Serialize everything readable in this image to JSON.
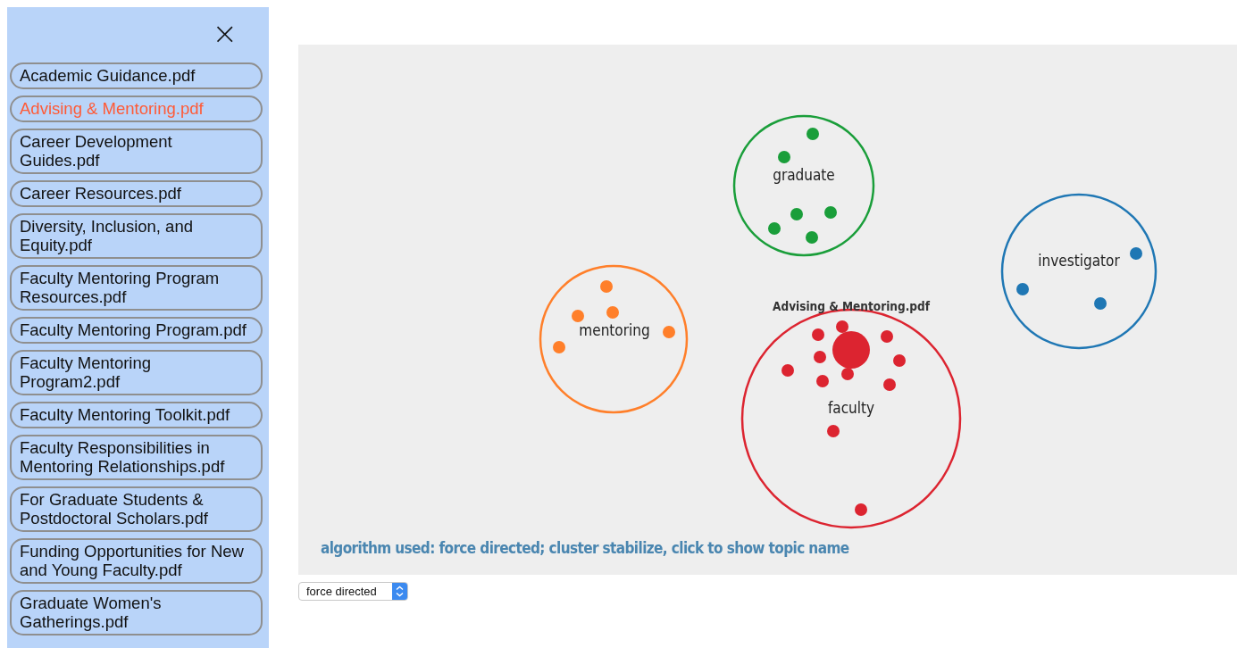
{
  "sidebar": {
    "close": "×",
    "files": [
      {
        "label": "Academic Guidance.pdf",
        "selected": false
      },
      {
        "label": "Advising & Mentoring.pdf",
        "selected": true
      },
      {
        "label": "Career Development Guides.pdf",
        "selected": false
      },
      {
        "label": "Career Resources.pdf",
        "selected": false
      },
      {
        "label": "Diversity, Inclusion, and Equity.pdf",
        "selected": false
      },
      {
        "label": "Faculty Mentoring Program Resources.pdf",
        "selected": false
      },
      {
        "label": "Faculty Mentoring Program.pdf",
        "selected": false
      },
      {
        "label": "Faculty Mentoring Program2.pdf",
        "selected": false
      },
      {
        "label": "Faculty Mentoring Toolkit.pdf",
        "selected": false
      },
      {
        "label": "Faculty Responsibilities in Mentoring Relationships.pdf",
        "selected": false
      },
      {
        "label": "For Graduate Students & Postdoctoral Scholars.pdf",
        "selected": false
      },
      {
        "label": "Funding Opportunities for New and Young Faculty.pdf",
        "selected": false
      },
      {
        "label": "Graduate Women's Gatherings.pdf",
        "selected": false
      }
    ]
  },
  "graph": {
    "clusters": [
      {
        "name": "graduate",
        "color": "#1a9e3a"
      },
      {
        "name": "investigator",
        "color": "#1f77b4"
      },
      {
        "name": "mentoring",
        "color": "#ff7f2a"
      },
      {
        "name": "faculty",
        "color": "#dc2430"
      }
    ],
    "document_label": "Advising & Mentoring.pdf",
    "caption": "algorithm used: force directed; cluster stabilize, click to show topic name"
  },
  "algorithm_select": {
    "value": "force directed"
  }
}
